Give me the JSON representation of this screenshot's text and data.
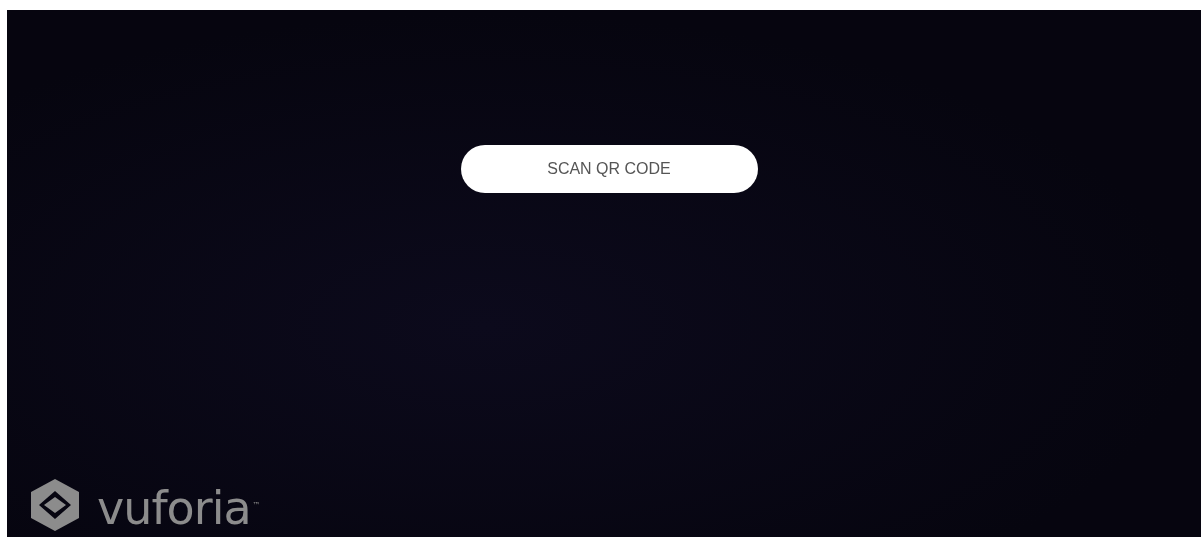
{
  "scan_button": {
    "label": "SCAN QR CODE"
  },
  "logo": {
    "wordmark": "vuforia",
    "trademark": "™"
  }
}
